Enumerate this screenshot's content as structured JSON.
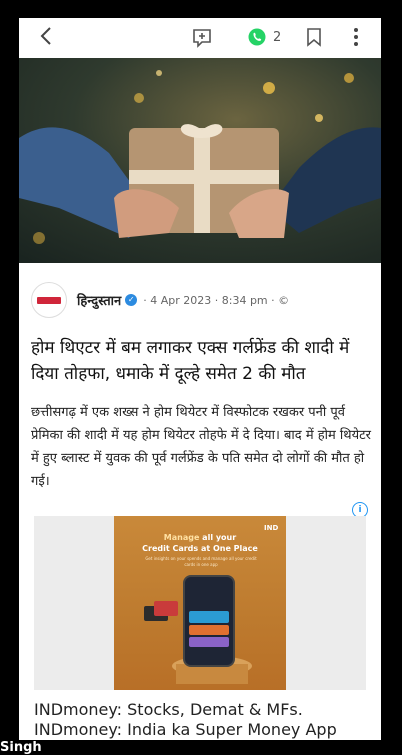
{
  "toolbar": {
    "back_icon": "chevron-left-icon",
    "comment_icon": "comment-plus-icon",
    "share_icon": "whatsapp-icon",
    "share_count": "2",
    "bookmark_icon": "bookmark-icon",
    "more_icon": "more-vertical-icon"
  },
  "article": {
    "source_name": "हिन्दुस्तान",
    "meta": "· 4 Apr 2023 · 8:34 pm · ©",
    "headline": "होम थिएटर में बम लगाकर एक्स गर्लफ्रेंड की शादी में दिया तोहफा, धमाके में दूल्हे समेत 2 की मौत",
    "body": "छत्तीसगढ़ में एक शख्स ने होम थियेटर में विस्फोटक रखकर पनी पूर्व प्रेमिका की शादी में यह होम थियेटर तोहफे में दे दिया। बाद में होम थियेटर में हुए ब्लास्ट में युवक की पूर्व गर्लफ्रेंड के पति समेत दो लोगों की मौत हो गई।"
  },
  "ad": {
    "brand_logo": "IND",
    "headline_highlight": "Manage",
    "headline_rest": " all your",
    "headline_line2": "Credit Cards at One Place",
    "sub_text": "Get insights on your spends and manage all your credit cards in one app",
    "title": "INDmoney: Stocks, Demat & MFs.",
    "subtitle": "INDmoney: India ka Super Money App"
  },
  "overlay": {
    "name": "Singh"
  },
  "colors": {
    "whatsapp": "#25d366",
    "verified": "#2c8be0",
    "ad_info": "#2196f3"
  }
}
